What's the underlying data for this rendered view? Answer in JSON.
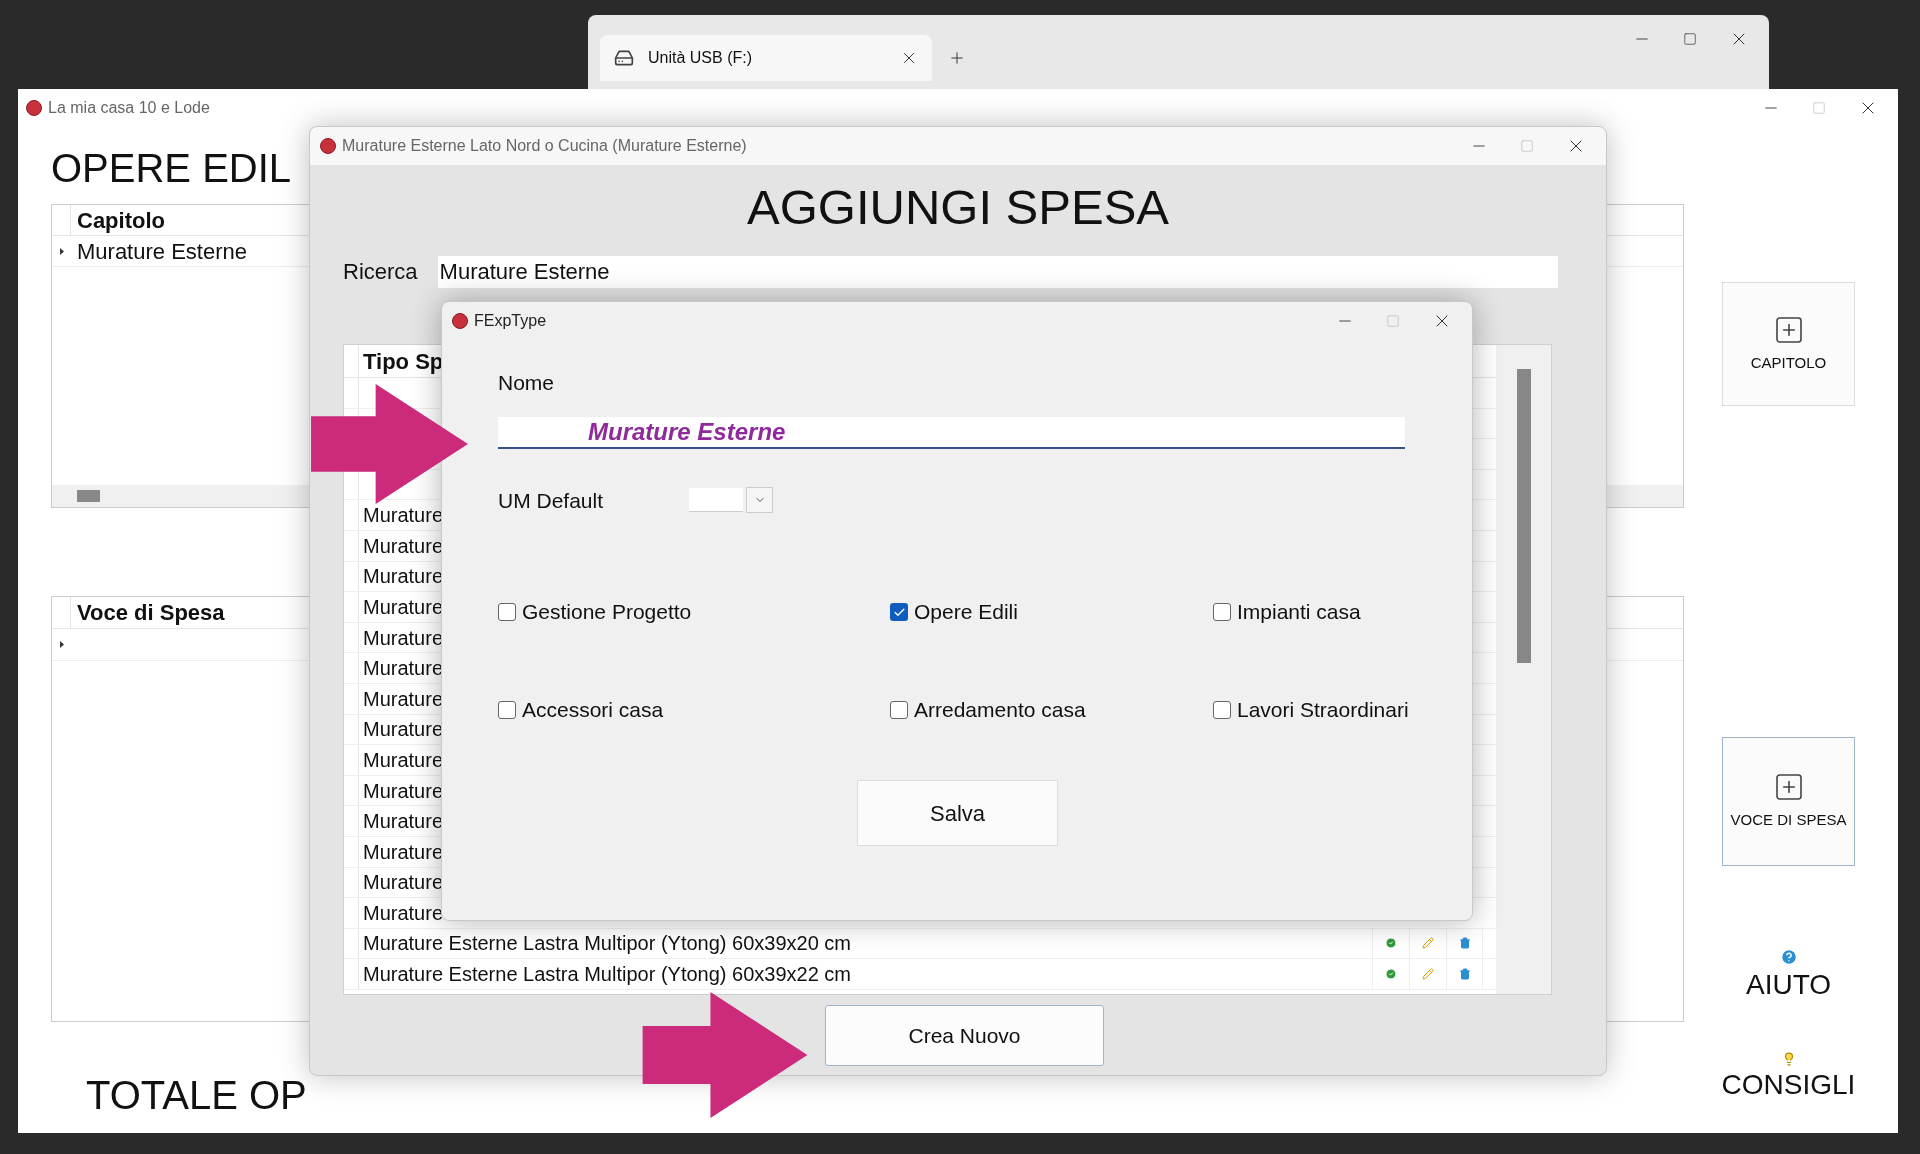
{
  "explorer_window": {
    "tab": {
      "label": "Unità USB (F:)"
    }
  },
  "main_window": {
    "title": "La mia casa 10 e Lode",
    "heading": "OPERE EDIL",
    "chapter_grid": {
      "header": "Capitolo",
      "rows": [
        {
          "text": "Murature Esterne",
          "current": true
        }
      ]
    },
    "expense_grid": {
      "header": "Voce di Spesa",
      "rows": [
        {
          "current": true
        }
      ]
    },
    "total": "TOTALE OP",
    "buttons": [
      {
        "label": "CAPITOLO"
      },
      {
        "label": "VOCE DI SPESA"
      }
    ],
    "links": [
      {
        "kind": "help",
        "label": "AIUTO"
      },
      {
        "kind": "tips",
        "label": "CONSIGLI"
      }
    ]
  },
  "add_expense_window": {
    "title": "Murature Esterne Lato Nord o Cucina (Murature Esterne)",
    "heading": "AGGIUNGI SPESA",
    "search": {
      "label": "Ricerca",
      "value": "Murature Esterne"
    },
    "grid": {
      "header": "Tipo Sp",
      "rows": [
        {
          "text": "Murature",
          "actions": false
        },
        {
          "text": "Murature",
          "actions": false
        },
        {
          "text": "Murature",
          "actions": false
        },
        {
          "text": "Murature",
          "actions": false
        },
        {
          "text": "Murature",
          "actions": false
        },
        {
          "text": "Murature",
          "actions": false
        },
        {
          "text": "Murature",
          "actions": false
        },
        {
          "text": "Murature",
          "actions": false
        },
        {
          "text": "Murature",
          "actions": false
        },
        {
          "text": "Murature",
          "actions": false
        },
        {
          "text": "Murature",
          "actions": false
        },
        {
          "text": "Murature",
          "actions": false
        },
        {
          "text": "Murature",
          "actions": false
        },
        {
          "text": "Murature",
          "actions": false
        },
        {
          "text": "Murature Esterne Lastra Multipor (Ytong) 60x39x20 cm",
          "actions": true
        },
        {
          "text": "Murature Esterne Lastra Multipor (Ytong) 60x39x22 cm",
          "actions": true
        }
      ]
    },
    "create_button": "Crea Nuovo"
  },
  "type_dialog": {
    "title": "FExpType",
    "name": {
      "label": "Nome",
      "value": "Murature Esterne"
    },
    "um_default": {
      "label": "UM Default"
    },
    "categories": [
      {
        "label": "Gestione Progetto",
        "checked": false
      },
      {
        "label": "Opere Edili",
        "checked": true
      },
      {
        "label": "Impianti casa",
        "checked": false
      },
      {
        "label": "Accessori casa",
        "checked": false
      },
      {
        "label": "Arredamento casa",
        "checked": false
      },
      {
        "label": "Lavori Straordinari",
        "checked": false
      }
    ],
    "save_button": "Salva"
  }
}
